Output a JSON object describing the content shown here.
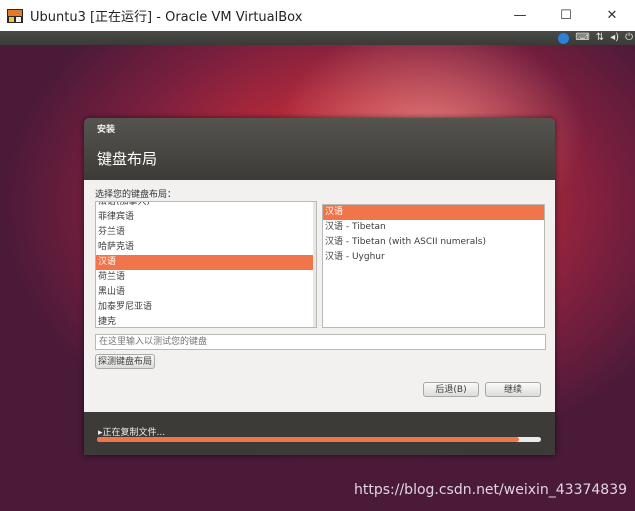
{
  "window": {
    "title": "Ubuntu3 [正在运行] - Oracle VM VirtualBox",
    "controls": {
      "minimize": "—",
      "maximize": "☐",
      "close": "✕"
    }
  },
  "vm_bar": {
    "icons": [
      "accessibility-icon",
      "keyboard-icon",
      "network-icon",
      "volume-icon",
      "power-icon"
    ],
    "keyboard": "⌨",
    "network": "⇅",
    "volume": "◂)",
    "power": "⏻"
  },
  "installer": {
    "title_small": "安装",
    "title_large": "键盘布局",
    "prompt": "选择您的键盘布局：",
    "layouts": [
      "法语(加拿大)",
      "菲律宾语",
      "芬兰语",
      "哈萨克语",
      "汉语",
      "荷兰语",
      "黑山语",
      "加泰罗尼亚语",
      "捷克"
    ],
    "selected_layout": "汉语",
    "variants": [
      "汉语",
      "汉语 - Tibetan",
      "汉语 - Tibetan (with ASCII numerals)",
      "汉语 - Uyghur"
    ],
    "selected_variant": "汉语",
    "test_placeholder": "在这里输入以测试您的键盘",
    "detect_button": "探测键盘布局",
    "back_button": "后退(B)",
    "continue_button": "继续",
    "status": "▸正在复制文件...",
    "progress": 0.95
  },
  "colors": {
    "accent": "#f0754a",
    "header": "#3c3b37"
  },
  "watermark": "https://blog.csdn.net/weixin_43374839"
}
